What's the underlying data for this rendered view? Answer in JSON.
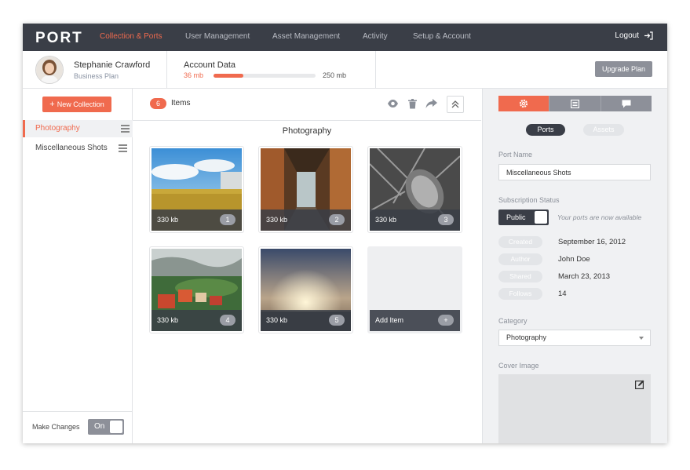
{
  "nav": {
    "logo": "PORT",
    "items": [
      "Collection & Ports",
      "User Management",
      "Asset Management",
      "Activity",
      "Setup & Account"
    ],
    "logout": "Logout"
  },
  "user": {
    "name": "Stephanie Crawford",
    "plan": "Business Plan"
  },
  "account": {
    "label": "Account Data",
    "used": "36 mb",
    "total": "250 mb",
    "usage_fraction": 0.29,
    "upgrade": "Upgrade Plan"
  },
  "sidebar": {
    "new_collection": "New Collection",
    "collections": [
      "Photography",
      "Miscellaneous Shots"
    ],
    "make_changes": "Make Changes",
    "toggle": "On"
  },
  "main": {
    "count": "6",
    "items_label": "Items",
    "section_title": "Photography",
    "cards": [
      {
        "size": "330 kb",
        "num": "1"
      },
      {
        "size": "330 kb",
        "num": "2"
      },
      {
        "size": "330 kb",
        "num": "3"
      },
      {
        "size": "330 kb",
        "num": "4"
      },
      {
        "size": "330 kb",
        "num": "5"
      }
    ],
    "add_item": "Add Item"
  },
  "panel": {
    "pill_ports": "Ports",
    "pill_assets": "Assets",
    "port_name_label": "Port Name",
    "port_name": "Miscellaneous Shots",
    "subscription_label": "Subscription Status",
    "status": "Public",
    "status_note": "Your ports are now available",
    "meta": [
      {
        "key": "Created",
        "value": "September 16, 2012"
      },
      {
        "key": "Author",
        "value": "John Doe"
      },
      {
        "key": "Shared",
        "value": "March 23, 2013"
      },
      {
        "key": "Follows",
        "value": "14"
      }
    ],
    "category_label": "Category",
    "category": "Photography",
    "cover_label": "Cover Image"
  },
  "colors": {
    "accent": "#f06a4e",
    "nav_bg": "#3a3e47",
    "gray_button": "#8d9099"
  }
}
